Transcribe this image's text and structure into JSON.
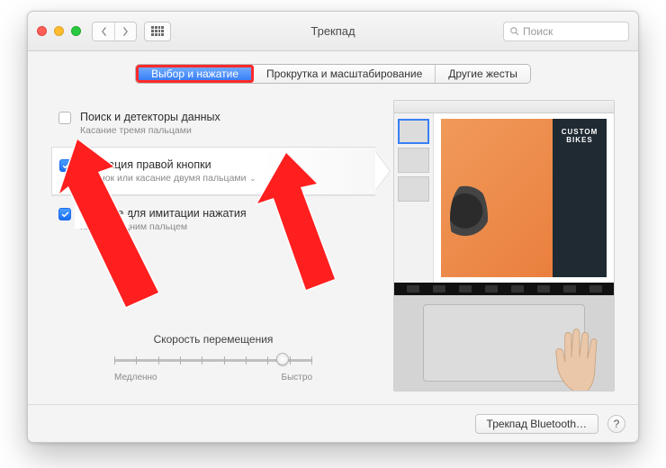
{
  "window": {
    "title": "Трекпад"
  },
  "toolbar": {
    "search_placeholder": "Поиск"
  },
  "tabs": {
    "items": [
      {
        "label": "Выбор и нажатие",
        "active": true
      },
      {
        "label": "Прокрутка и масштабирование",
        "active": false
      },
      {
        "label": "Другие жесты",
        "active": false
      }
    ]
  },
  "options": [
    {
      "label": "Поиск и детекторы данных",
      "sub": "Касание тремя пальцами",
      "checked": false,
      "has_dropdown": false,
      "selected": false
    },
    {
      "label": "Имитация правой кнопки",
      "sub": "Щелчок или касание двумя пальцами",
      "checked": true,
      "has_dropdown": true,
      "selected": true
    },
    {
      "label": "Касание для имитации нажатия",
      "sub": "Касание одним пальцем",
      "checked": true,
      "has_dropdown": false,
      "selected": false
    }
  ],
  "slider": {
    "title": "Скорость перемещения",
    "min_label": "Медленно",
    "max_label": "Быстро",
    "ticks": 10,
    "value_percent": 85
  },
  "preview": {
    "poster_line1": "CUSTOM",
    "poster_line2": "BIKES"
  },
  "footer": {
    "bluetooth_button": "Трекпад Bluetooth…",
    "help": "?"
  },
  "colors": {
    "accent": "#3a7ff5",
    "arrow": "#ff1f1f"
  }
}
